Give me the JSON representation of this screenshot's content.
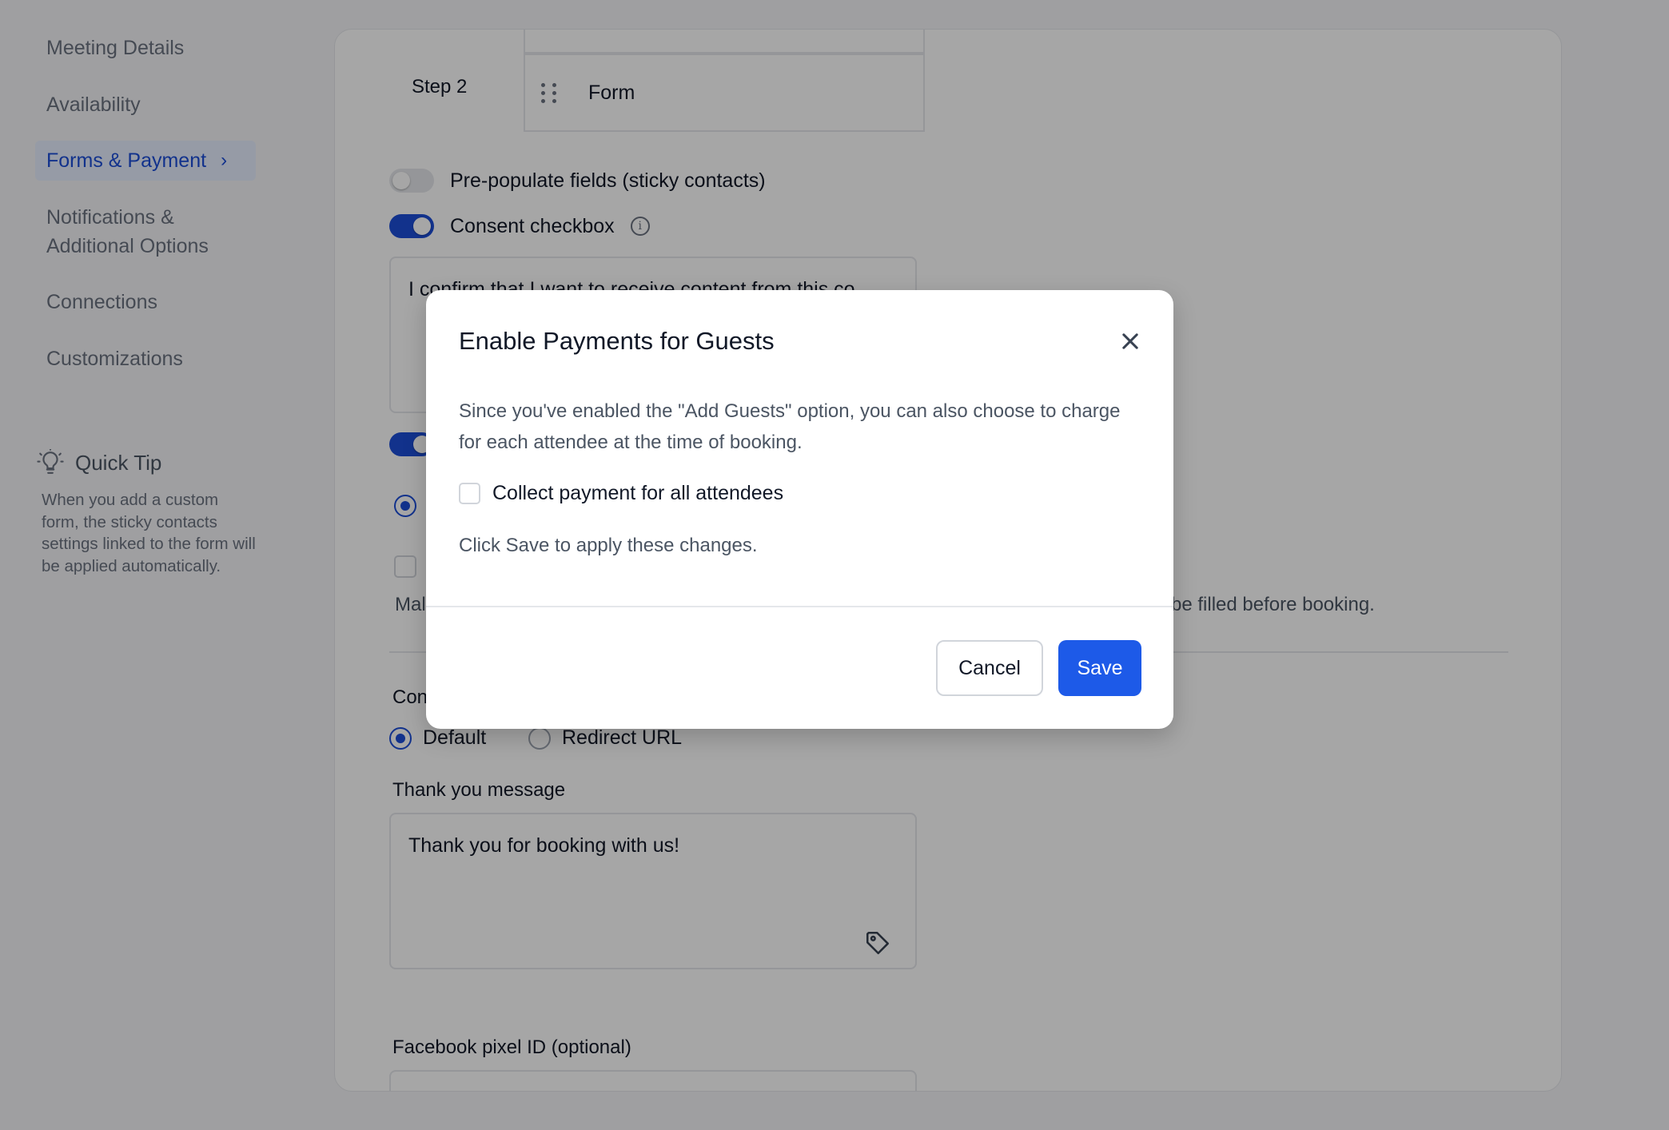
{
  "sidebar": {
    "items": [
      {
        "label": "Meeting Details"
      },
      {
        "label": "Availability"
      },
      {
        "label": "Forms & Payment"
      },
      {
        "label": "Notifications &"
      },
      {
        "label": "Additional Options"
      },
      {
        "label": "Connections"
      },
      {
        "label": "Customizations"
      }
    ],
    "quick_tip": {
      "title": "Quick Tip",
      "body": "When you add a custom form, the sticky contacts settings linked to the form will be applied automatically."
    }
  },
  "main": {
    "step_label": "Step 2",
    "form_item": "Form",
    "prepopulate_label": "Pre-populate fields (sticky contacts)",
    "consent_label": "Consent checkbox",
    "consent_text": "I confirm that I want to receive content from this co",
    "partial_label_left": "Mal",
    "partial_label_right": "be filled before booking.",
    "partial_con": "Con",
    "radio_default": "Default",
    "radio_redirect": "Redirect URL",
    "thank_you_label": "Thank you message",
    "thank_you_text": "Thank you for booking with us!",
    "pixel_label": "Facebook pixel ID (optional)"
  },
  "modal": {
    "title": "Enable Payments for Guests",
    "description": "Since you've enabled the \"Add Guests\" option, you can also choose to charge for each attendee at the time of booking.",
    "checkbox_label": "Collect payment for all attendees",
    "note": "Click Save to apply these changes.",
    "cancel_label": "Cancel",
    "save_label": "Save"
  },
  "colors": {
    "accent": "#1d5ae8",
    "active_nav_bg": "#e7efff",
    "overlay": "rgba(0,0,0,0.35)"
  }
}
